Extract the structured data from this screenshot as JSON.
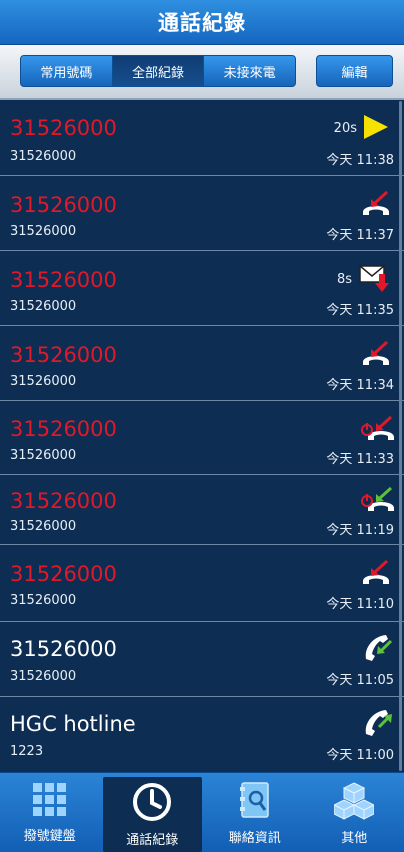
{
  "header": {
    "title": "通話紀錄"
  },
  "toolbar": {
    "segments": [
      {
        "label": "常用號碼",
        "active": false
      },
      {
        "label": "全部紀錄",
        "active": true
      },
      {
        "label": "未接來電",
        "active": false
      }
    ],
    "edit_label": "編輯"
  },
  "calls": [
    {
      "name": "31526000",
      "number": "31526000",
      "time": "今天 11:38",
      "duration": "20s",
      "status": "missed",
      "icon": "play-voicemail-icon"
    },
    {
      "name": "31526000",
      "number": "31526000",
      "time": "今天 11:37",
      "duration": "",
      "status": "missed",
      "icon": "missed-call-icon"
    },
    {
      "name": "31526000",
      "number": "31526000",
      "time": "今天 11:35",
      "duration": "8s",
      "status": "missed",
      "icon": "voicemail-envelope-icon"
    },
    {
      "name": "31526000",
      "number": "31526000",
      "time": "今天 11:34",
      "duration": "",
      "status": "missed",
      "icon": "missed-call-icon"
    },
    {
      "name": "31526000",
      "number": "31526000",
      "time": "今天 11:33",
      "duration": "",
      "status": "missed",
      "icon": "missed-call-power-icon"
    },
    {
      "name": "31526000",
      "number": "31526000",
      "time": "今天 11:19",
      "duration": "",
      "status": "missed",
      "icon": "incoming-call-power-icon"
    },
    {
      "name": "31526000",
      "number": "31526000",
      "time": "今天 11:10",
      "duration": "",
      "status": "missed",
      "icon": "missed-call-icon"
    },
    {
      "name": "31526000",
      "number": "31526000",
      "time": "今天 11:05",
      "duration": "",
      "status": "normal",
      "icon": "incoming-call-icon"
    },
    {
      "name": "HGC hotline",
      "number": "1223",
      "time": "今天 11:00",
      "duration": "",
      "status": "normal",
      "icon": "outgoing-call-icon"
    }
  ],
  "tabbar": {
    "tabs": [
      {
        "label": "撥號鍵盤",
        "icon": "keypad-icon",
        "active": false
      },
      {
        "label": "通話紀錄",
        "icon": "clock-icon",
        "active": true
      },
      {
        "label": "聯絡資訊",
        "icon": "contacts-book-icon",
        "active": false
      },
      {
        "label": "其他",
        "icon": "cubes-icon",
        "active": false
      }
    ]
  },
  "colors": {
    "missed": "#e0192a",
    "normal": "#ffffff",
    "background": "#0e2d52",
    "accent": "#1a73c9"
  }
}
